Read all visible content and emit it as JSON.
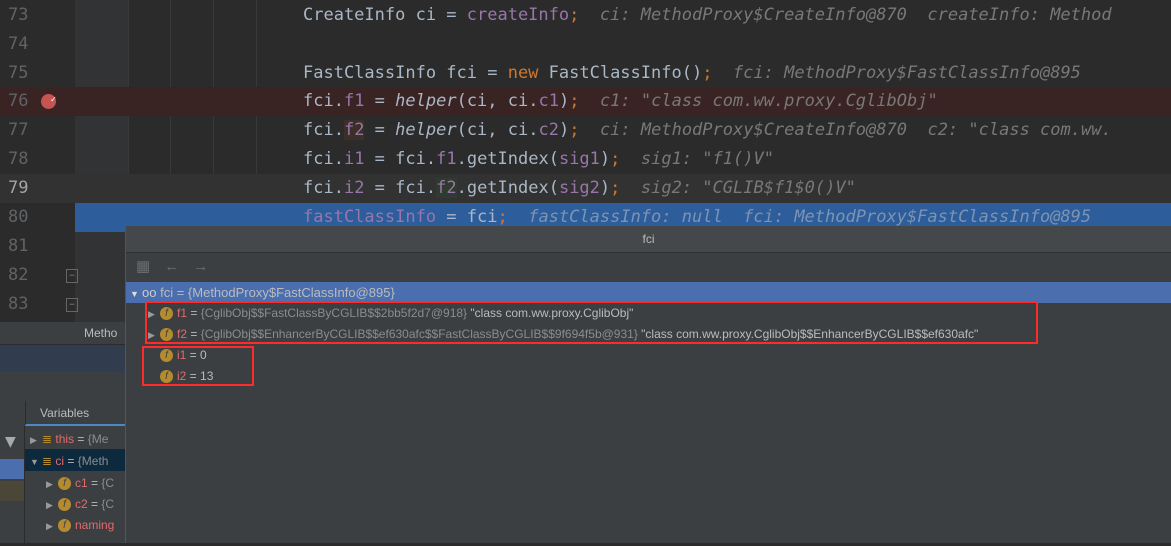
{
  "editor": {
    "lines": [
      {
        "n": "73",
        "hint": "ci: MethodProxy$CreateInfo@870  createInfo: Method"
      },
      {
        "n": "74"
      },
      {
        "n": "75",
        "hint": "fci: MethodProxy$FastClassInfo@895"
      },
      {
        "n": "76",
        "hint": "c1: \"class com.ww.proxy.CglibObj\""
      },
      {
        "n": "77",
        "hint": "ci: MethodProxy$CreateInfo@870  c2: \"class com.ww."
      },
      {
        "n": "78",
        "hint": "sig1: \"f1()V\""
      },
      {
        "n": "79",
        "hint": "sig2: \"CGLIB$f1$0()V\""
      },
      {
        "n": "80",
        "hint": "fastClassInfo: null  fci: MethodProxy$FastClassInfo@895"
      },
      {
        "n": "81"
      },
      {
        "n": "82"
      },
      {
        "n": "83"
      }
    ],
    "code": {
      "l73a": "CreateInfo ci = ",
      "l73b": "createInfo",
      ";": ";",
      "l75a": "FastClassInfo fci = ",
      "l75new": "new",
      "l75b": " FastClassInfo()",
      "fci": "fci.",
      "f1": "f1",
      "f2": "f2",
      "i1": "i1",
      "i2": "i2",
      "eq": " = ",
      "helper": "helper",
      "l76args": "(ci, ci.",
      "c1": "c1",
      "c2": "c2",
      "close": ")",
      "getIndex": ".getIndex(",
      "sig1": "sig1",
      "sig2": "sig2",
      "fcidot": "fci.",
      "l80a": "fastClassInfo",
      "l80b": " = fci"
    }
  },
  "popup": {
    "title": "fci",
    "root": {
      "name": "fci",
      "value": "{MethodProxy$FastClassInfo@895}"
    },
    "children": [
      {
        "name": "f1",
        "value": "{CglibObj$$FastClassByCGLIB$$2bb5f2d7@918}",
        "str": "\"class com.ww.proxy.CglibObj\""
      },
      {
        "name": "f2",
        "value": "{CglibObj$$EnhancerByCGLIB$$ef630afc$$FastClassByCGLIB$$9f694f5b@931}",
        "str": "\"class com.ww.proxy.CglibObj$$EnhancerByCGLIB$$ef630afc\""
      },
      {
        "name": "i1",
        "value": "0"
      },
      {
        "name": "i2",
        "value": "13"
      }
    ]
  },
  "left": {
    "tab": "Metho",
    "variables_tab": "Variables",
    "vars": [
      {
        "name": "this",
        "value": "{Me"
      },
      {
        "name": "ci",
        "value": "{Meth"
      },
      {
        "name": "c1",
        "value": "{C"
      },
      {
        "name": "c2",
        "value": "{C"
      },
      {
        "name": "naming",
        "value": ""
      }
    ]
  },
  "colors": {
    "highlight": "#2f65ca",
    "breakpoint": "#c75450",
    "redbox": "#ff2a2a"
  }
}
